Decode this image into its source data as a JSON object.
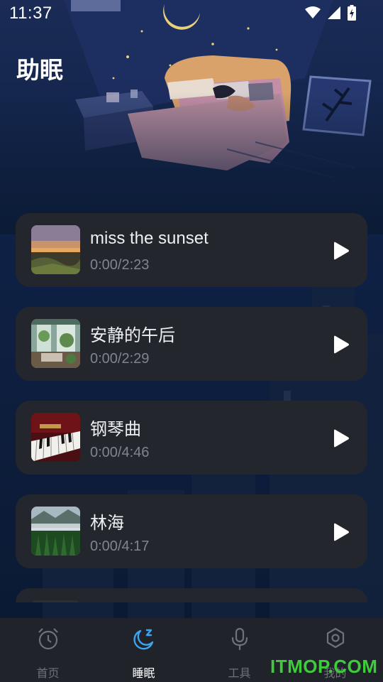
{
  "status_bar": {
    "time": "11:37"
  },
  "page": {
    "title": "助眠"
  },
  "tracks": [
    {
      "title": "miss the sunset",
      "time": "0:00/2:23",
      "thumb": "sunset-thumbnail"
    },
    {
      "title": "安静的午后",
      "time": "0:00/2:29",
      "thumb": "cozy-room-thumbnail"
    },
    {
      "title": "钢琴曲",
      "time": "0:00/4:46",
      "thumb": "piano-thumbnail"
    },
    {
      "title": "林海",
      "time": "0:00/4:17",
      "thumb": "forest-thumbnail"
    }
  ],
  "nav": {
    "items": [
      {
        "label": "首页",
        "icon": "alarm-clock-icon",
        "active": false
      },
      {
        "label": "睡眠",
        "icon": "moon-zzz-icon",
        "active": true
      },
      {
        "label": "工具",
        "icon": "microphone-icon",
        "active": false
      },
      {
        "label": "我的",
        "icon": "gear-icon",
        "active": false
      }
    ]
  },
  "watermark": "ITMOP.COM",
  "colors": {
    "accent": "#3aa5f0",
    "card_bg": "#23272d",
    "page_bg": "#0c1c36",
    "nav_bg": "#20242a"
  }
}
